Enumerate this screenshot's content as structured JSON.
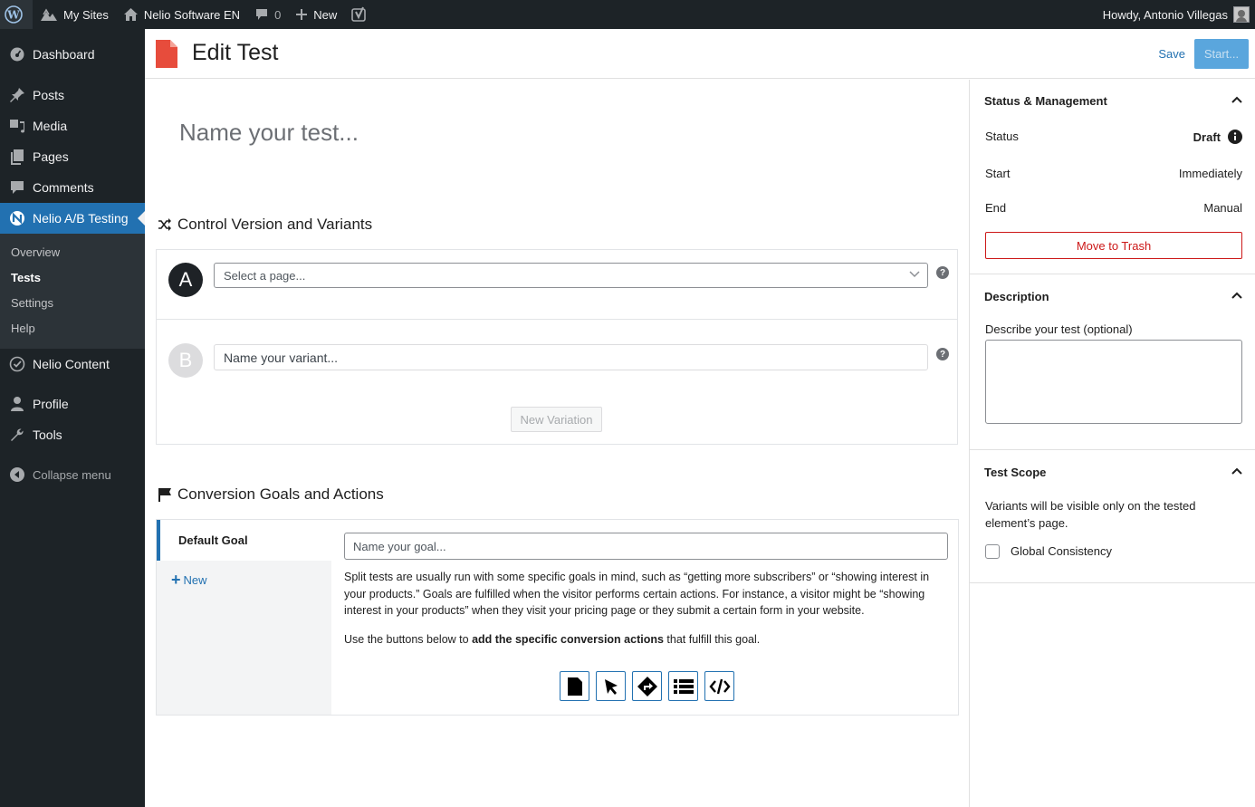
{
  "admin_bar": {
    "my_sites": "My Sites",
    "site_name": "Nelio Software EN",
    "comments_count": "0",
    "new_label": "New",
    "greeting": "Howdy, Antonio Villegas"
  },
  "sidebar": {
    "items": [
      {
        "label": "Dashboard",
        "icon": "dashboard-icon"
      },
      {
        "label": "Posts",
        "icon": "pin-icon"
      },
      {
        "label": "Media",
        "icon": "media-icon"
      },
      {
        "label": "Pages",
        "icon": "pages-icon"
      },
      {
        "label": "Comments",
        "icon": "comment-icon"
      },
      {
        "label": "Nelio A/B Testing",
        "icon": "nelio-icon"
      },
      {
        "label": "Nelio Content",
        "icon": "nelio-content-icon"
      },
      {
        "label": "Profile",
        "icon": "user-icon"
      },
      {
        "label": "Tools",
        "icon": "wrench-icon"
      }
    ],
    "submenu": [
      "Overview",
      "Tests",
      "Settings",
      "Help"
    ],
    "collapse": "Collapse menu"
  },
  "header": {
    "title": "Edit Test",
    "save": "Save",
    "start": "Start..."
  },
  "editor": {
    "name_placeholder": "Name your test...",
    "variants_title": "Control Version and Variants",
    "variant_a": {
      "badge": "A",
      "placeholder": "Select a page..."
    },
    "variant_b": {
      "badge": "B",
      "placeholder": "Name your variant..."
    },
    "help_glyph": "?",
    "new_variation": "New Variation",
    "goals_title": "Conversion Goals and Actions",
    "default_goal": "Default Goal",
    "new_goal": "New",
    "goal_placeholder": "Name your goal...",
    "goal_paragraph": "Split tests are usually run with some specific goals in mind, such as “getting more subscribers” or “showing interest in your products.” Goals are fulfilled when the visitor performs certain actions. For instance, a visitor might be “showing interest in your products” when they visit your pricing page or they submit a certain form in your website.",
    "actions_prefix": "Use the buttons below to ",
    "actions_bold": "add the specific conversion actions",
    "actions_suffix": " that fulfill this goal.",
    "action_icons": [
      "page-visit-icon",
      "click-icon",
      "directions-icon",
      "form-list-icon",
      "custom-code-icon"
    ]
  },
  "panel": {
    "status": {
      "title": "Status & Management",
      "status_label": "Status",
      "status_value": "Draft",
      "start_label": "Start",
      "start_value": "Immediately",
      "end_label": "End",
      "end_value": "Manual",
      "trash": "Move to Trash"
    },
    "description": {
      "title": "Description",
      "label": "Describe your test (optional)"
    },
    "scope": {
      "title": "Test Scope",
      "text": "Variants will be visible only on the tested element’s page.",
      "checkbox_label": "Global Consistency",
      "checkbox_checked": false
    }
  },
  "colors": {
    "accent": "#2271b1",
    "admin_dark": "#1d2327",
    "danger": "#cc1818",
    "doc_icon": "#e74c3c"
  }
}
